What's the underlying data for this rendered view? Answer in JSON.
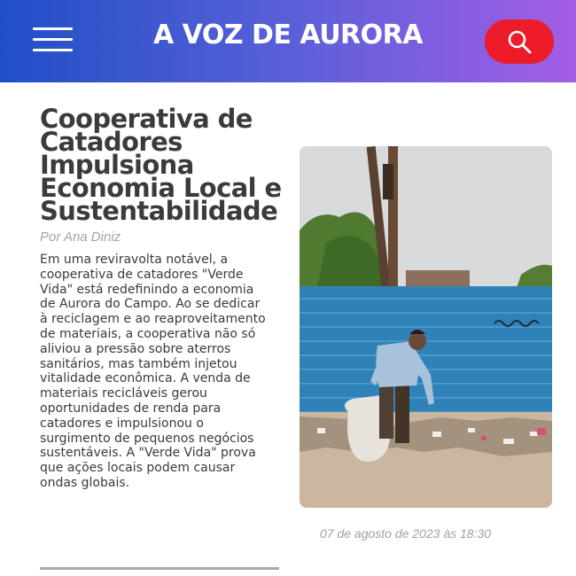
{
  "header": {
    "site_title": "A VOZ DE AURORA",
    "menu_icon": "hamburger-menu-icon",
    "search_icon": "search-icon",
    "search_button_color": "#ec1c2b",
    "gradient_start": "#1f4fc6",
    "gradient_end": "#a35ee6"
  },
  "article": {
    "headline": "Cooperativa de Catadores Impulsiona Economia Local e Sustentabilidade",
    "byline": "Por Ana Diniz",
    "body": "Em uma reviravolta notável, a cooperativa de catadores \"Verde Vida\" está redefinindo a economia de Aurora do Campo. Ao se dedicar à reciclagem e ao reaproveitamento de materiais, a cooperativa não só aliviou a pressão sobre aterros sanitários, mas também injetou vitalidade econômica. A venda de materiais recicláveis gerou oportunidades de renda para catadores e impulsionou o surgimento de pequenos negócios sustentáveis. A \"Verde Vida\" prova que ações locais podem causar ondas globais.",
    "date": "07  de agosto de 2023 às 18:30"
  }
}
